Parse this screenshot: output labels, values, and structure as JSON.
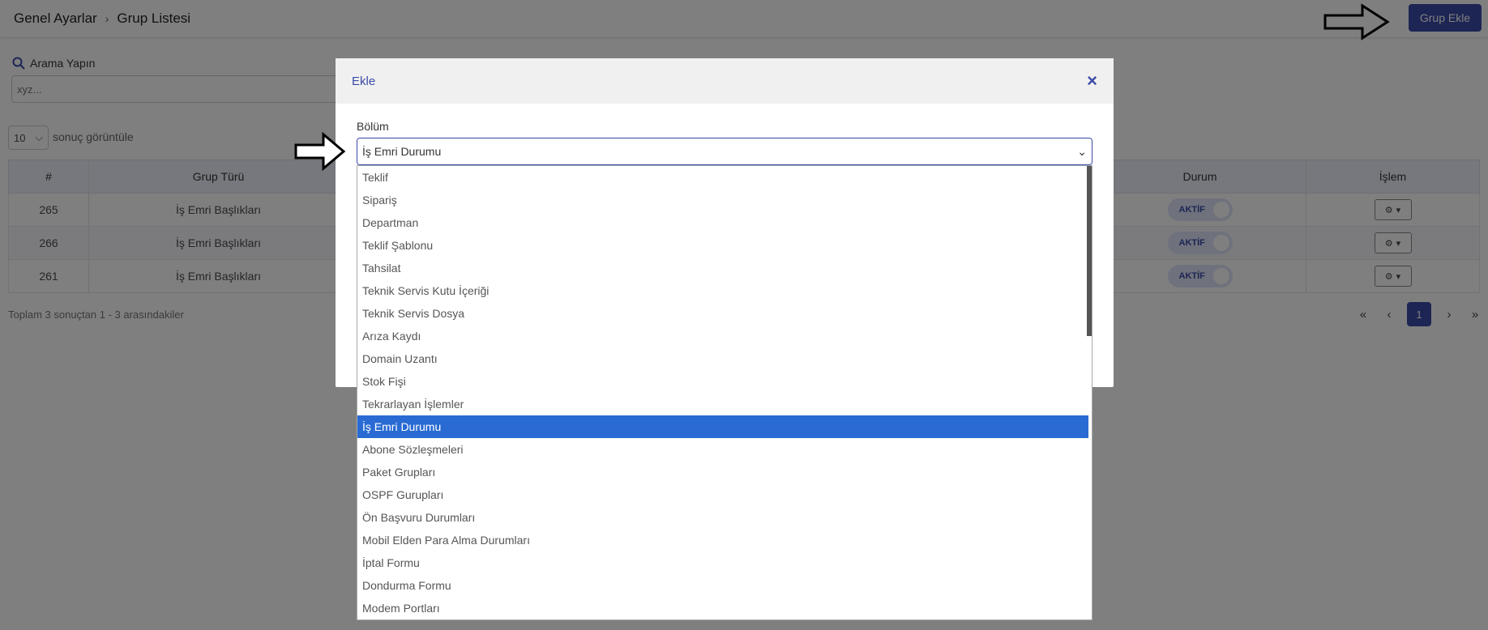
{
  "breadcrumb": {
    "parent": "Genel Ayarlar",
    "current": "Grup Listesi"
  },
  "header": {
    "add_button": "Grup Ekle"
  },
  "search": {
    "label": "Arama Yapın",
    "placeholder": "xyz..."
  },
  "page_size": {
    "value": "10",
    "label": "sonuç görüntüle"
  },
  "table": {
    "headers": [
      "#",
      "Grup Türü",
      "Durum",
      "İşlem"
    ],
    "rows": [
      {
        "id": "265",
        "type": "İş Emri Başlıkları",
        "status": "AKTİF"
      },
      {
        "id": "266",
        "type": "İş Emri Başlıkları",
        "status": "AKTİF"
      },
      {
        "id": "261",
        "type": "İş Emri Başlıkları",
        "status": "AKTİF"
      }
    ]
  },
  "footer": {
    "summary": "Toplam 3 sonuçtan 1 - 3 arasındakiler"
  },
  "pagination": {
    "first": "«",
    "prev": "‹",
    "current": "1",
    "next": "›",
    "last": "»"
  },
  "modal": {
    "title": "Ekle",
    "close": "×",
    "field_label": "Bölüm",
    "selected": "İş Emri Durumu",
    "options": [
      "Teklif",
      "Sipariş",
      "Departman",
      "Teklif Şablonu",
      "Tahsilat",
      "Teknik Servis Kutu İçeriği",
      "Teknik Servis Dosya",
      "Arıza Kaydı",
      "Domain Uzantı",
      "Stok Fişi",
      "Tekrarlayan İşlemler",
      "İş Emri Durumu",
      "Abone Sözleşmeleri",
      "Paket Grupları",
      "OSPF Gurupları",
      "Ön Başvuru Durumları",
      "Mobil Elden Para Alma Durumları",
      "İptal Formu",
      "Dondurma Formu",
      "Modem Portları"
    ]
  },
  "colors": {
    "primary": "#3b4aa8",
    "selection": "#2a6bd3"
  }
}
